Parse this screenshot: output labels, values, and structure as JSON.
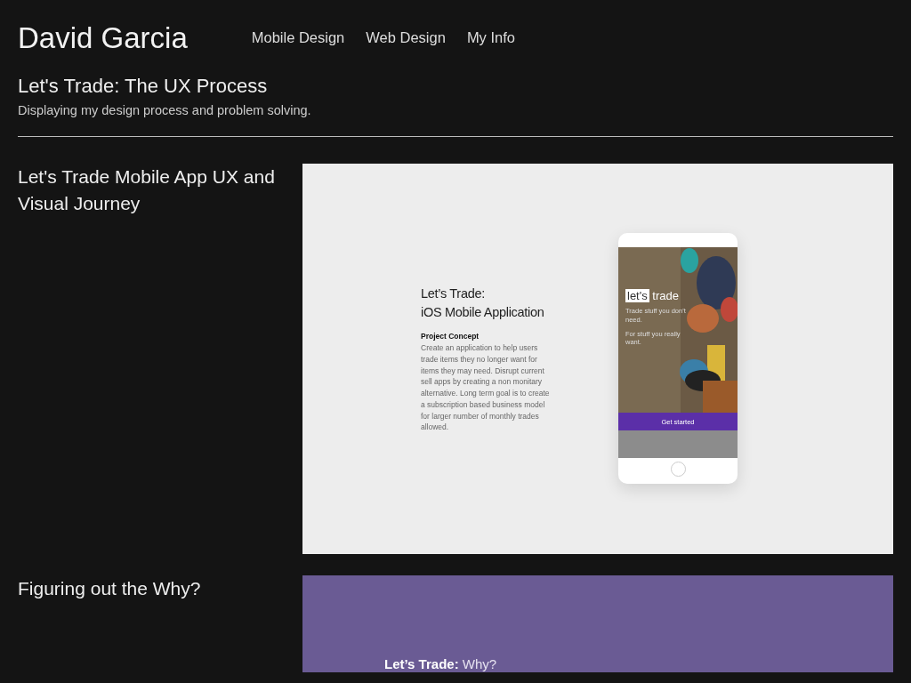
{
  "header": {
    "brand": "David Garcia",
    "nav": [
      {
        "label": "Mobile Design"
      },
      {
        "label": "Web Design"
      },
      {
        "label": "My Info"
      }
    ]
  },
  "intro": {
    "title": "Let's Trade: The UX Process",
    "subtitle": "Displaying my design process and problem solving."
  },
  "sections": [
    {
      "kind": "concept",
      "heading": "Let's Trade Mobile App UX and Visual Journey",
      "slide": {
        "title_lines": [
          "Let’s Trade:",
          "iOS Mobile Application"
        ],
        "concept_label": "Project Concept",
        "concept_text": "Create an application to help users trade items they no longer want for items they may need. Disrupt current sell apps by creating a non monitary alternative. Long term goal is to create a subscription based business model for larger number of  monthly trades allowed.",
        "phone": {
          "logo_boxed": "let's",
          "logo_rest": "trade",
          "taglines": [
            "Trade stuff you don't need.",
            "For stuff you really want."
          ],
          "button": "Get started"
        }
      }
    },
    {
      "kind": "why",
      "heading": "Figuring out the Why?",
      "slide": {
        "title": "**Let’s Trade:** Why?"
      }
    }
  ]
}
